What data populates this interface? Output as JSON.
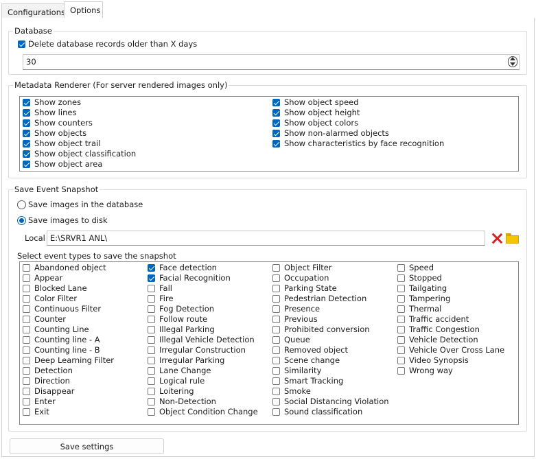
{
  "tabs": [
    {
      "label": "Configurations",
      "active": false
    },
    {
      "label": "Options",
      "active": true
    }
  ],
  "database": {
    "title": "Database",
    "delete_checkbox": {
      "label": "Delete database records older than X days",
      "checked": true
    },
    "days_value": "30"
  },
  "metadata": {
    "title": "Metadata Renderer (For server rendered images only)",
    "col1": [
      {
        "label": "Show zones",
        "checked": true
      },
      {
        "label": "Show lines",
        "checked": true
      },
      {
        "label": "Show counters",
        "checked": true
      },
      {
        "label": "Show objects",
        "checked": true
      },
      {
        "label": "Show object trail",
        "checked": true
      },
      {
        "label": "Show object classification",
        "checked": true
      },
      {
        "label": "Show object area",
        "checked": true
      }
    ],
    "col2": [
      {
        "label": "Show object speed",
        "checked": true
      },
      {
        "label": "Show object height",
        "checked": true
      },
      {
        "label": "Show object colors",
        "checked": true
      },
      {
        "label": "Show non-alarmed objects",
        "checked": true
      },
      {
        "label": "Show characteristics by face recognition",
        "checked": true
      }
    ]
  },
  "snapshot": {
    "title": "Save Event Snapshot",
    "radio_db": {
      "label": "Save images in the database",
      "checked": false
    },
    "radio_disk": {
      "label": "Save images to disk",
      "checked": true
    },
    "local_label": "Local",
    "local_path": "E:\\SRVR1 ANL\\",
    "event_types_label": "Select event types to save the snapshot",
    "events": [
      [
        {
          "label": "Abandoned object",
          "checked": false
        },
        {
          "label": "Appear",
          "checked": false
        },
        {
          "label": "Blocked Lane",
          "checked": false
        },
        {
          "label": "Color Filter",
          "checked": false
        },
        {
          "label": "Continuous Filter",
          "checked": false
        },
        {
          "label": "Counter",
          "checked": false
        },
        {
          "label": "Counting Line",
          "checked": false
        },
        {
          "label": "Counting line - A",
          "checked": false
        },
        {
          "label": "Counting line - B",
          "checked": false
        },
        {
          "label": "Deep Learning Filter",
          "checked": false
        },
        {
          "label": "Detection",
          "checked": false
        },
        {
          "label": "Direction",
          "checked": false
        },
        {
          "label": "Disappear",
          "checked": false
        },
        {
          "label": "Enter",
          "checked": false
        },
        {
          "label": "Exit",
          "checked": false
        }
      ],
      [
        {
          "label": "Face detection",
          "checked": true
        },
        {
          "label": "Facial Recognition",
          "checked": true
        },
        {
          "label": "Fall",
          "checked": false
        },
        {
          "label": "Fire",
          "checked": false
        },
        {
          "label": "Fog Detection",
          "checked": false
        },
        {
          "label": "Follow route",
          "checked": false
        },
        {
          "label": "Illegal Parking",
          "checked": false
        },
        {
          "label": "Illegal Vehicle Detection",
          "checked": false
        },
        {
          "label": "Irregular Construction",
          "checked": false
        },
        {
          "label": "Irregular Parking",
          "checked": false
        },
        {
          "label": "Lane Change",
          "checked": false
        },
        {
          "label": "Logical rule",
          "checked": false
        },
        {
          "label": "Loitering",
          "checked": false
        },
        {
          "label": "Non-Detection",
          "checked": false
        },
        {
          "label": "Object Condition Change",
          "checked": false
        }
      ],
      [
        {
          "label": "Object Filter",
          "checked": false
        },
        {
          "label": "Occupation",
          "checked": false
        },
        {
          "label": "Parking State",
          "checked": false
        },
        {
          "label": "Pedestrian Detection",
          "checked": false
        },
        {
          "label": "Presence",
          "checked": false
        },
        {
          "label": "Previous",
          "checked": false
        },
        {
          "label": "Prohibited conversion",
          "checked": false
        },
        {
          "label": "Queue",
          "checked": false
        },
        {
          "label": "Removed object",
          "checked": false
        },
        {
          "label": "Scene change",
          "checked": false
        },
        {
          "label": "Similarity",
          "checked": false
        },
        {
          "label": "Smart Tracking",
          "checked": false
        },
        {
          "label": "Smoke",
          "checked": false
        },
        {
          "label": "Social Distancing Violation",
          "checked": false
        },
        {
          "label": "Sound classification",
          "checked": false
        }
      ],
      [
        {
          "label": "Speed",
          "checked": false
        },
        {
          "label": "Stopped",
          "checked": false
        },
        {
          "label": "Tailgating",
          "checked": false
        },
        {
          "label": "Tampering",
          "checked": false
        },
        {
          "label": "Thermal",
          "checked": false
        },
        {
          "label": "Traffic accident",
          "checked": false
        },
        {
          "label": "Traffic Congestion",
          "checked": false
        },
        {
          "label": "Vehicle Detection",
          "checked": false
        },
        {
          "label": "Vehicle Over Cross Lane",
          "checked": false
        },
        {
          "label": "Video Synopsis",
          "checked": false
        },
        {
          "label": "Wrong way",
          "checked": false
        }
      ]
    ]
  },
  "save_button": {
    "label": "Save settings"
  },
  "icons": {
    "delete": "delete-x-icon",
    "folder": "folder-icon"
  },
  "colors": {
    "accent": "#0067c0",
    "delete": "#d62222",
    "folder": "#f5c400"
  }
}
